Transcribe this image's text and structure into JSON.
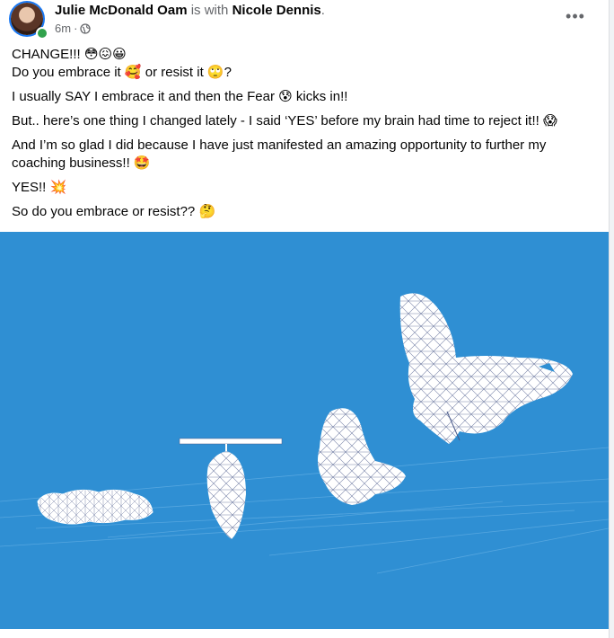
{
  "post": {
    "author": "Julie McDonald Oam",
    "with_text": "is with",
    "tagged": "Nicole Dennis",
    "period": ".",
    "time": "6m",
    "separator": "·",
    "privacy_icon": "globe-icon",
    "more_label": "•••",
    "lines": [
      "CHANGE!!! 😳😖😀",
      "Do you embrace it 🥰 or resist it 🙄?",
      "I usually SAY I embrace it and then the Fear 😰 kicks in!!",
      "But.. here’s one thing I changed lately - I said ‘YES’ before my brain had time to reject it!! 😱",
      "And I’m so glad I did because I have just manifested an amazing opportunity to further my coaching business!! 🤩",
      "YES!! 💥",
      "So do you embrace or resist?? 🤔"
    ]
  },
  "image": {
    "subject": "caterpillar-chrysalis-butterfly-transformation",
    "background": "#2f8fd3",
    "stages": [
      "caterpillar",
      "chrysalis",
      "emerging-butterfly",
      "butterfly"
    ]
  },
  "colors": {
    "author_text": "#050505",
    "meta_text": "#65676b",
    "online": "#31a24c",
    "accent": "#1877f2"
  }
}
